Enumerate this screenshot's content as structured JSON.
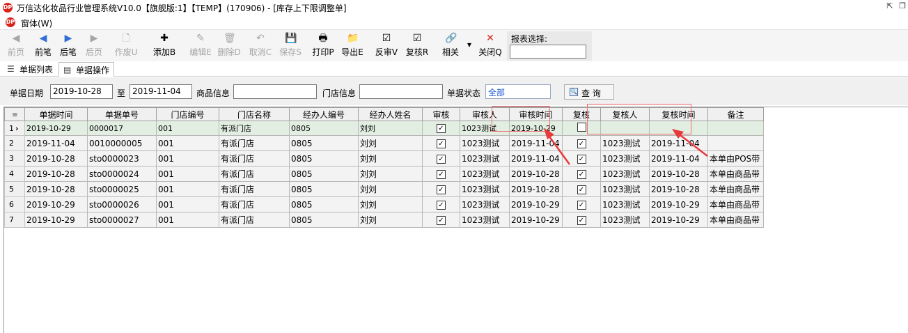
{
  "window": {
    "title": "万信达化妆品行业管理系统V10.0【旗舰版:1】【TEMP】(170906) - [库存上下限调整单]",
    "restore_symbol": "⇱",
    "max_symbol": "❐"
  },
  "app": {
    "logo_text": "DP"
  },
  "menu": {
    "window_label": "窗体(W)"
  },
  "toolbar": {
    "buttons": [
      {
        "label": "前页",
        "icon": "◀",
        "enabled": false
      },
      {
        "label": "前笔",
        "icon": "◀",
        "enabled": true
      },
      {
        "label": "后笔",
        "icon": "▶",
        "enabled": true
      },
      {
        "label": "后页",
        "icon": "▶",
        "enabled": false
      },
      {
        "label": "作废U",
        "icon": "🗋",
        "enabled": false
      },
      {
        "label": "添加B",
        "icon": "✚",
        "enabled": true
      },
      {
        "label": "编辑E",
        "icon": "✎",
        "enabled": false
      },
      {
        "label": "删除D",
        "icon": "🗑",
        "enabled": false
      },
      {
        "label": "取消C",
        "icon": "↶",
        "enabled": false
      },
      {
        "label": "保存S",
        "icon": "💾",
        "enabled": false
      },
      {
        "label": "打印P",
        "icon": "🖶",
        "enabled": true
      },
      {
        "label": "导出E",
        "icon": "📁",
        "enabled": true
      },
      {
        "label": "反审V",
        "icon": "☑",
        "enabled": true
      },
      {
        "label": "复核R",
        "icon": "☑",
        "enabled": true
      },
      {
        "label": "相关",
        "icon": "🔗",
        "enabled": true
      },
      {
        "label": "关闭Q",
        "icon": "✕",
        "enabled": true
      }
    ],
    "dropdown_symbol": "▾",
    "report_label": "报表选择:",
    "report_value": ""
  },
  "tabs": [
    {
      "label": "单据列表",
      "icon": "☰"
    },
    {
      "label": "单据操作",
      "icon": "▤"
    }
  ],
  "filter": {
    "date_label": "单据日期",
    "date_from": "2019-10-28",
    "to_label": "至",
    "date_to": "2019-11-04",
    "goods_label": "商品信息",
    "goods_value": "",
    "store_label": "门店信息",
    "store_value": "",
    "status_label": "单据状态",
    "status_value": "全部",
    "query_label": "查  询"
  },
  "grid": {
    "corner_icon": "≡",
    "columns": [
      "单据时间",
      "单据单号",
      "门店编号",
      "门店名称",
      "经办人编号",
      "经办人姓名",
      "审核",
      "审核人",
      "审核时间",
      "复核",
      "复核人",
      "复核时间",
      "备注"
    ],
    "rows": [
      {
        "num": "1",
        "marker": "›",
        "date": "2019-10-29",
        "no": "0000017",
        "store_code": "001",
        "store_name": "有派门店",
        "handler_code": "0805",
        "handler_name": "刘刘",
        "audited": true,
        "auditor": "1023测试",
        "audit_time": "2019-10-29",
        "reviewed": false,
        "reviewer": "",
        "review_time": "",
        "remark": ""
      },
      {
        "num": "2",
        "marker": "",
        "date": "2019-11-04",
        "no": "0010000005",
        "store_code": "001",
        "store_name": "有派门店",
        "handler_code": "0805",
        "handler_name": "刘刘",
        "audited": true,
        "auditor": "1023测试",
        "audit_time": "2019-11-04",
        "reviewed": true,
        "reviewer": "1023测试",
        "review_time": "2019-11-04",
        "remark": ""
      },
      {
        "num": "3",
        "marker": "",
        "date": "2019-10-28",
        "no": "sto0000023",
        "store_code": "001",
        "store_name": "有派门店",
        "handler_code": "0805",
        "handler_name": "刘刘",
        "audited": true,
        "auditor": "1023测试",
        "audit_time": "2019-11-04",
        "reviewed": true,
        "reviewer": "1023测试",
        "review_time": "2019-11-04",
        "remark": "本单由POS带"
      },
      {
        "num": "4",
        "marker": "",
        "date": "2019-10-28",
        "no": "sto0000024",
        "store_code": "001",
        "store_name": "有派门店",
        "handler_code": "0805",
        "handler_name": "刘刘",
        "audited": true,
        "auditor": "1023测试",
        "audit_time": "2019-10-28",
        "reviewed": true,
        "reviewer": "1023测试",
        "review_time": "2019-10-28",
        "remark": "本单由商品带"
      },
      {
        "num": "5",
        "marker": "",
        "date": "2019-10-28",
        "no": "sto0000025",
        "store_code": "001",
        "store_name": "有派门店",
        "handler_code": "0805",
        "handler_name": "刘刘",
        "audited": true,
        "auditor": "1023测试",
        "audit_time": "2019-10-28",
        "reviewed": true,
        "reviewer": "1023测试",
        "review_time": "2019-10-28",
        "remark": "本单由商品带"
      },
      {
        "num": "6",
        "marker": "",
        "date": "2019-10-29",
        "no": "sto0000026",
        "store_code": "001",
        "store_name": "有派门店",
        "handler_code": "0805",
        "handler_name": "刘刘",
        "audited": true,
        "auditor": "1023测试",
        "audit_time": "2019-10-29",
        "reviewed": true,
        "reviewer": "1023测试",
        "review_time": "2019-10-29",
        "remark": "本单由商品带"
      },
      {
        "num": "7",
        "marker": "",
        "date": "2019-10-29",
        "no": "sto0000027",
        "store_code": "001",
        "store_name": "有派门店",
        "handler_code": "0805",
        "handler_name": "刘刘",
        "audited": true,
        "auditor": "1023测试",
        "audit_time": "2019-10-29",
        "reviewed": true,
        "reviewer": "1023测试",
        "review_time": "2019-10-29",
        "remark": "本单由商品带"
      }
    ]
  },
  "colors": {
    "annotation_red": "#e83a3a",
    "selected_row": "#e2eee2",
    "status_blue": "#1e5bd8"
  }
}
